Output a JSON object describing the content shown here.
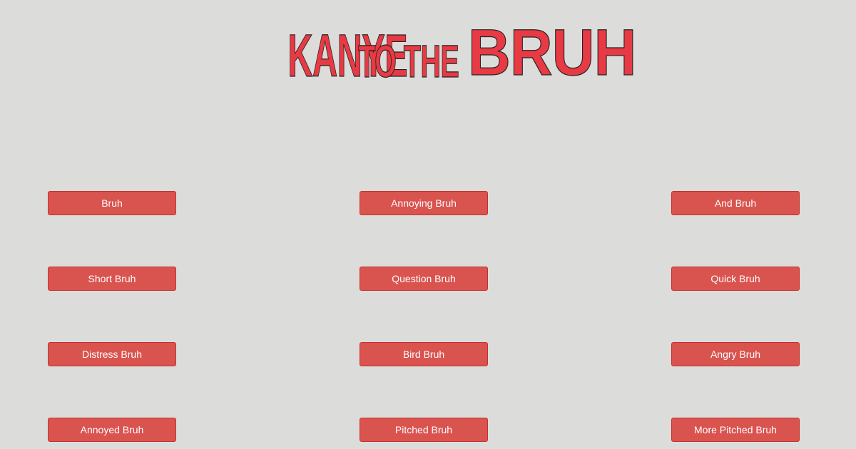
{
  "logo": {
    "word1": "KANYE",
    "word2": "TO THE",
    "word3": "BRUH"
  },
  "buttons": {
    "bruh": "Bruh",
    "annoying_bruh": "Annoying Bruh",
    "and_bruh": "And Bruh",
    "short_bruh": "Short Bruh",
    "question_bruh": "Question Bruh",
    "quick_bruh": "Quick Bruh",
    "distress_bruh": "Distress Bruh",
    "bird_bruh": "Bird Bruh",
    "angry_bruh": "Angry Bruh",
    "annoyed_bruh": "Annoyed Bruh",
    "pitched_bruh": "Pitched Bruh",
    "more_pitched_bruh": "More Pitched Bruh"
  },
  "colors": {
    "background": "#dcdcda",
    "logo_fill": "#e83a44",
    "button": "#d9534f",
    "button_text": "#ffffff"
  }
}
